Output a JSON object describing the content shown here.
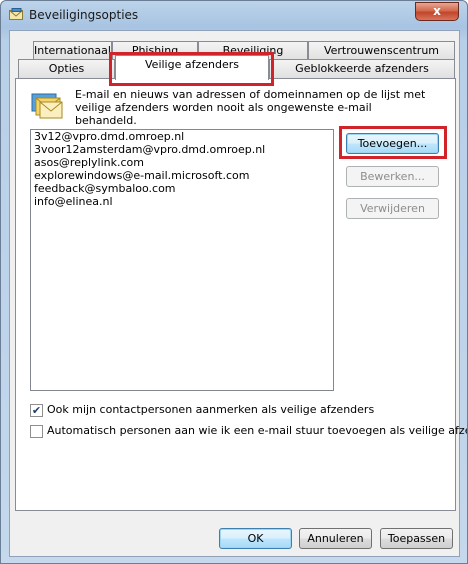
{
  "window": {
    "title": "Beveiligingsopties",
    "close_glyph": "x"
  },
  "tabs": {
    "back_row": [
      {
        "label": "Internationaal"
      },
      {
        "label": "Phishing"
      },
      {
        "label": "Beveiliging"
      },
      {
        "label": "Vertrouwenscentrum"
      }
    ],
    "front_row": [
      {
        "label": "Opties"
      },
      {
        "label": "Veilige afzenders",
        "active": true
      },
      {
        "label": "Geblokkeerde afzenders"
      }
    ]
  },
  "panel": {
    "description": "E-mail en nieuws van adressen of domeinnamen op de lijst met veilige afzenders worden nooit als ongewenste e-mail behandeld.",
    "icon": "envelopes-icon",
    "senders": [
      "3v12@vpro.dmd.omroep.nl",
      "3voor12amsterdam@vpro.dmd.omroep.nl",
      "asos@replylink.com",
      "explorewindows@e-mail.microsoft.com",
      "feedback@symbaloo.com",
      "info@elinea.nl"
    ],
    "buttons": {
      "add": "Toevoegen...",
      "edit": "Bewerken...",
      "remove": "Verwijderen"
    },
    "checkboxes": {
      "contacts": {
        "label": "Ook mijn contactpersonen aanmerken als veilige afzenders",
        "checked": true
      },
      "auto_add": {
        "label": "Automatisch personen aan wie ik een e-mail stuur toevoegen als veilige afzenders",
        "checked": false
      }
    }
  },
  "footer": {
    "ok": "OK",
    "cancel": "Annuleren",
    "apply": "Toepassen"
  },
  "colors": {
    "highlight": "#d1232a"
  }
}
